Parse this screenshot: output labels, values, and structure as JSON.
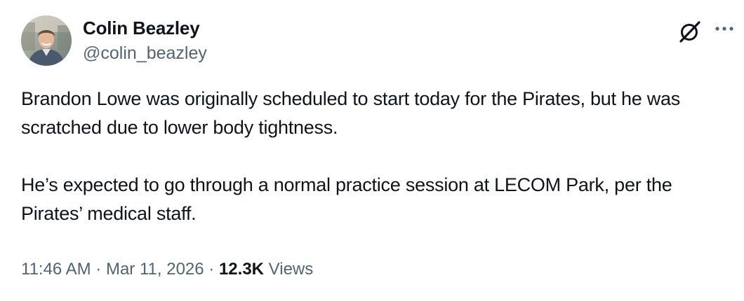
{
  "author": {
    "display_name": "Colin Beazley",
    "handle": "@colin_beazley"
  },
  "post": {
    "paragraphs": [
      "Brandon Lowe was originally scheduled to start today for the Pirates, but he was scratched due to lower body tightness.",
      "He’s expected to go through a normal practice session at LECOM Park, per the Pirates’ medical staff."
    ]
  },
  "meta": {
    "time": "11:46 AM",
    "separator": "·",
    "date": "Mar 11, 2026",
    "views_count": "12.3K",
    "views_label": "Views"
  },
  "icons": {
    "grok": "grok-icon",
    "more": "more-icon"
  },
  "colors": {
    "text_primary": "#0f1419",
    "text_secondary": "#536471"
  }
}
